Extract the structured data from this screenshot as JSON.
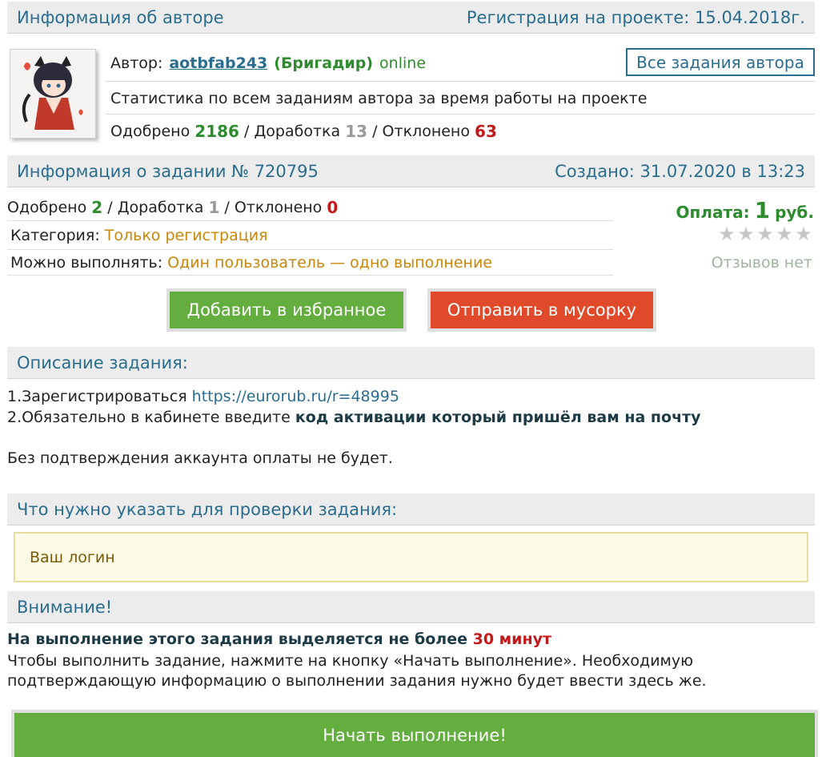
{
  "author_section": {
    "heading": "Информация об авторе",
    "registration": "Регистрация на проекте: 15.04.2018г.",
    "author_label": "Автор:",
    "author_login": "aotbfab243",
    "author_rank": "(Бригадир)",
    "author_status": "online",
    "all_tasks_button": "Все задания автора",
    "stats_description": "Статистика по всем заданиям автора за время работы на проекте",
    "stats": {
      "approved_label": "Одобрено",
      "approved": "2186",
      "revision_label": "Доработка",
      "revision": "13",
      "rejected_label": "Отклонено",
      "rejected": "63",
      "separator": "/"
    }
  },
  "task_section": {
    "heading": "Информация о задании № 720795",
    "created": "Создано: 31.07.2020 в 13:23",
    "stats": {
      "approved_label": "Одобрено",
      "approved": "2",
      "revision_label": "Доработка",
      "revision": "1",
      "rejected_label": "Отклонено",
      "rejected": "0",
      "separator": "/"
    },
    "category_label": "Категория:",
    "category_value": "Только регистрация",
    "limit_label": "Можно выполнять:",
    "limit_value": "Один пользователь — одно выполнение",
    "payment_label": "Оплата:",
    "payment_amount": "1",
    "payment_currency": "руб.",
    "rating_stars": 0,
    "rating_max": 5,
    "reviews": "Отзывов нет",
    "favorite_button": "Добавить в избранное",
    "trash_button": "Отправить в мусорку"
  },
  "description_section": {
    "heading": "Описание задания:",
    "line1_prefix": "1.Зарегистрироваться",
    "line1_link": "https://eurorub.ru/r=48995",
    "line2_prefix": "2.Обязательно в кабинете введите",
    "line2_bold": "код активации который пришёл вам на почту",
    "line3": "Без подтверждения аккаунта оплаты не будет."
  },
  "check_section": {
    "heading": "Что нужно указать для проверки задания:",
    "value": "Ваш логин"
  },
  "attention_section": {
    "heading": "Внимание!",
    "time_text": "На выполнение этого задания выделяется не более",
    "time_value": "30 минут",
    "instruction": "Чтобы выполнить задание, нажмите на кнопку «Начать выполнение». Необходимую подтверждающую информацию о выполнении задания нужно будет ввести здесь же.",
    "start_button": "Начать выполнение!"
  },
  "colors": {
    "heading_blue": "#2a6d8f",
    "green": "#2e8b2e",
    "red": "#c21a1a",
    "orange": "#c8860a",
    "button_green": "#64ad3f",
    "button_red": "#e04a2b"
  }
}
